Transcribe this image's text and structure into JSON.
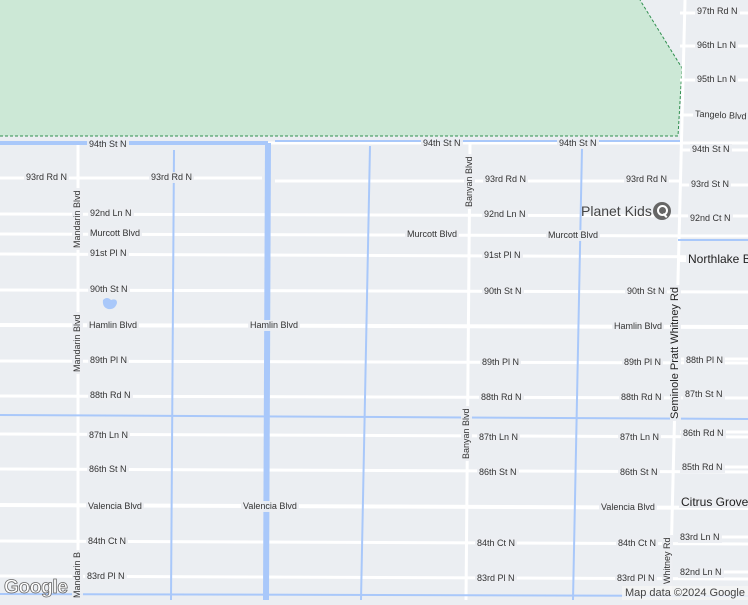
{
  "map": {
    "colors": {
      "background": "#ebeef2",
      "park": "#cce8d6",
      "park_border": "#2f8f4e",
      "water": "#a9c8fa",
      "road": "#ffffff",
      "pin": "#666666"
    },
    "road_labels": {
      "r97th_rd_n": "97th Rd N",
      "r96th_ln_n": "96th Ln N",
      "r95th_ln_n": "95th Ln N",
      "tangelo_blvd": "Tangelo Blvd",
      "r94th_st_n": "94th St N",
      "r93rd_rd_n": "93rd Rd N",
      "r93rd_st_n": "93rd St N",
      "r92nd_ln_n": "92nd Ln N",
      "r92nd_ct_n": "92nd Ct N",
      "murcott_blvd": "Murcott Blvd",
      "r91st_pl_n": "91st Pl N",
      "northlake_blvd": "Northlake B",
      "r90th_st_n": "90th St N",
      "hamlin_blvd": "Hamlin Blvd",
      "r89th_pl_n": "89th Pl N",
      "r88th_pl_n": "88th Pl N",
      "r88th_rd_n": "88th Rd N",
      "r87th_st_n": "87th St N",
      "r87th_ln_n": "87th Ln N",
      "r86th_rd_n": "86th Rd N",
      "r86th_st_n": "86th St N",
      "r85th_rd_n": "85th Rd N",
      "valencia_blvd": "Valencia Blvd",
      "citrus_grove": "Citrus Grove",
      "r84th_ct_n": "84th Ct N",
      "r83rd_ln_n": "83rd Ln N",
      "r83rd_pl_n": "83rd Pl N",
      "r82nd_ln_n": "82nd Ln N",
      "mandarin_blvd": "Mandarin Blvd",
      "mandarin_blvd_cut": "Mandarin B",
      "banyan_blvd": "Banyan Blvd",
      "seminole_pratt_whitney_rd": "Seminole Pratt Whitney Rd",
      "whitney_rd": "Whitney Rd"
    },
    "poi": {
      "name": "Planet Kids",
      "icon": "map-pin-icon"
    },
    "logo_text": "Google",
    "attribution": "Map data ©2024 Google"
  }
}
